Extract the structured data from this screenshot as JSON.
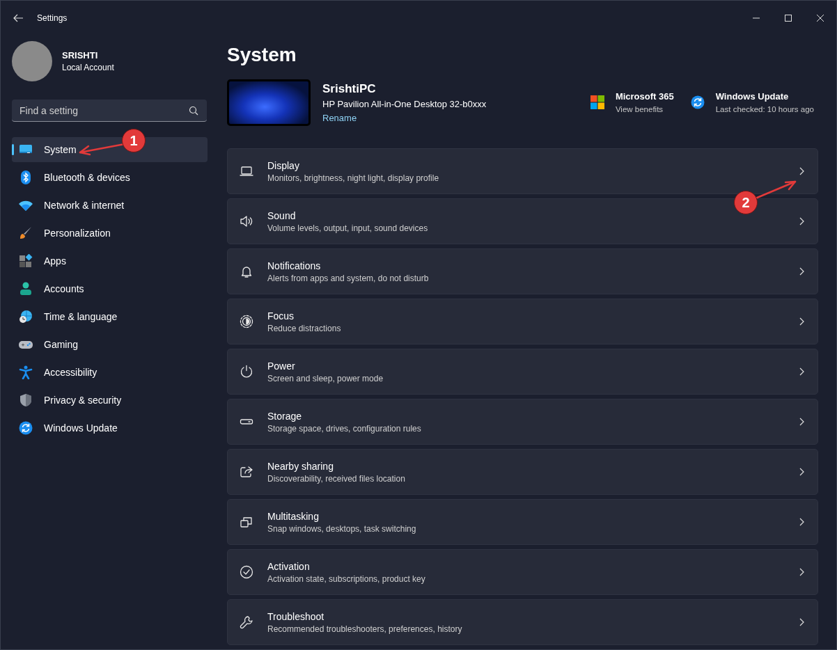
{
  "window": {
    "title": "Settings"
  },
  "profile": {
    "name": "SRISHTI",
    "account_type": "Local Account"
  },
  "search": {
    "placeholder": "Find a setting"
  },
  "nav": [
    {
      "label": "System",
      "kind": "system",
      "selected": true
    },
    {
      "label": "Bluetooth & devices",
      "kind": "bluetooth",
      "selected": false
    },
    {
      "label": "Network & internet",
      "kind": "network",
      "selected": false
    },
    {
      "label": "Personalization",
      "kind": "personalization",
      "selected": false
    },
    {
      "label": "Apps",
      "kind": "apps",
      "selected": false
    },
    {
      "label": "Accounts",
      "kind": "accounts",
      "selected": false
    },
    {
      "label": "Time & language",
      "kind": "time",
      "selected": false
    },
    {
      "label": "Gaming",
      "kind": "gaming",
      "selected": false
    },
    {
      "label": "Accessibility",
      "kind": "accessibility",
      "selected": false
    },
    {
      "label": "Privacy & security",
      "kind": "privacy",
      "selected": false
    },
    {
      "label": "Windows Update",
      "kind": "update",
      "selected": false
    }
  ],
  "page_title": "System",
  "device": {
    "name": "SrishtiPC",
    "model": "HP Pavilion All-in-One Desktop 32-b0xxx",
    "rename_link": "Rename"
  },
  "quick_links": [
    {
      "kind": "microsoft365",
      "title": "Microsoft 365",
      "subtitle": "View benefits"
    },
    {
      "kind": "update",
      "title": "Windows Update",
      "subtitle": "Last checked: 10 hours ago"
    }
  ],
  "settings": [
    {
      "kind": "display",
      "title": "Display",
      "subtitle": "Monitors, brightness, night light, display profile"
    },
    {
      "kind": "sound",
      "title": "Sound",
      "subtitle": "Volume levels, output, input, sound devices"
    },
    {
      "kind": "notifications",
      "title": "Notifications",
      "subtitle": "Alerts from apps and system, do not disturb"
    },
    {
      "kind": "focus",
      "title": "Focus",
      "subtitle": "Reduce distractions"
    },
    {
      "kind": "power",
      "title": "Power",
      "subtitle": "Screen and sleep, power mode"
    },
    {
      "kind": "storage",
      "title": "Storage",
      "subtitle": "Storage space, drives, configuration rules"
    },
    {
      "kind": "sharing",
      "title": "Nearby sharing",
      "subtitle": "Discoverability, received files location"
    },
    {
      "kind": "multitasking",
      "title": "Multitasking",
      "subtitle": "Snap windows, desktops, task switching"
    },
    {
      "kind": "activation",
      "title": "Activation",
      "subtitle": "Activation state, subscriptions, product key"
    },
    {
      "kind": "troubleshoot",
      "title": "Troubleshoot",
      "subtitle": "Recommended troubleshooters, preferences, history"
    }
  ],
  "annotations": [
    {
      "label": "1"
    },
    {
      "label": "2"
    }
  ]
}
